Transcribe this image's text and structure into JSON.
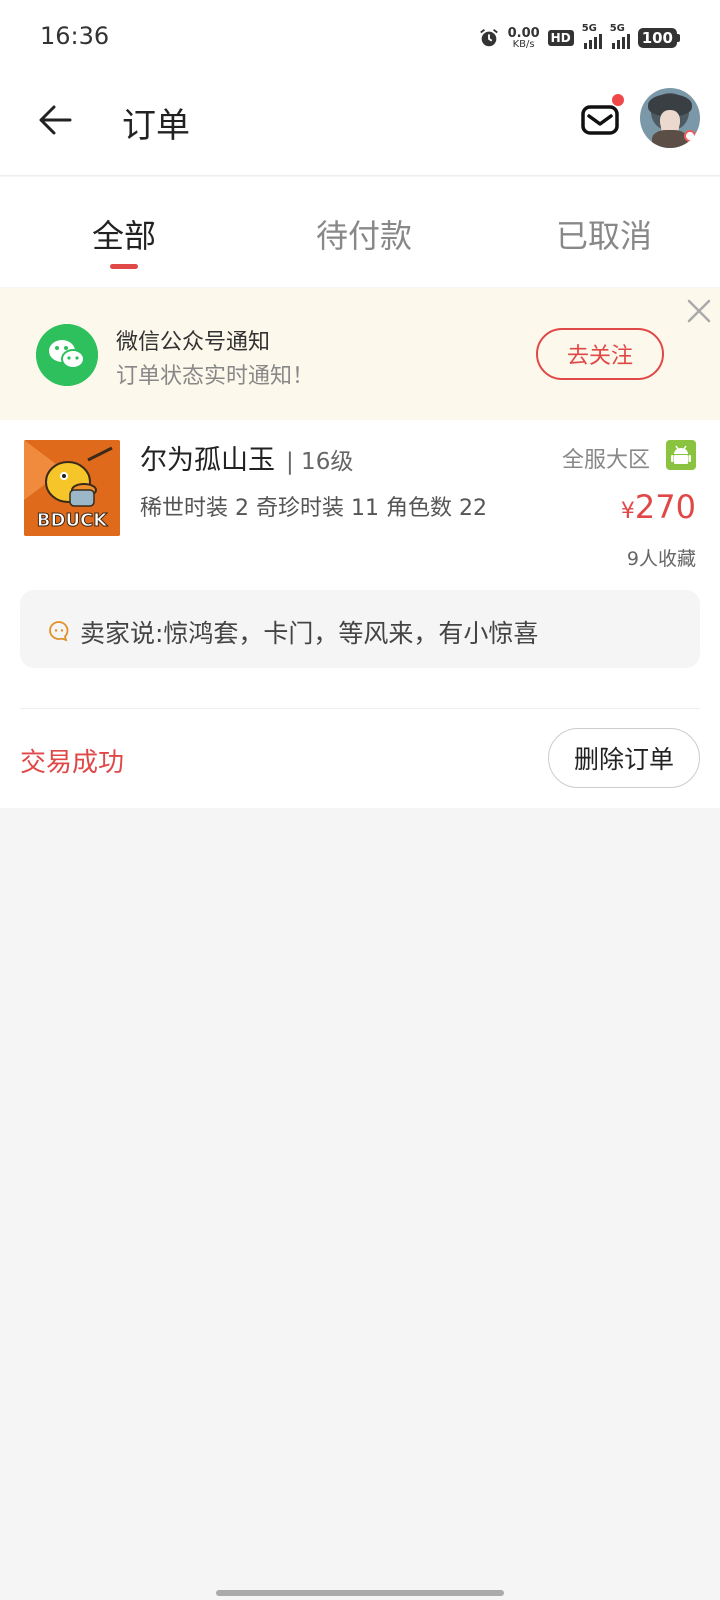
{
  "status_bar": {
    "time": "16:36",
    "net_speed_value": "0.00",
    "net_speed_unit": "KB/s",
    "hd_label": "HD",
    "sim1_label": "5G",
    "sim2_label": "5G",
    "battery": "100"
  },
  "header": {
    "title": "订单"
  },
  "tabs": [
    {
      "label": "全部",
      "active": true
    },
    {
      "label": "待付款",
      "active": false
    },
    {
      "label": "已取消",
      "active": false
    }
  ],
  "banner": {
    "title": "微信公众号通知",
    "subtitle": "订单状态实时通知！",
    "follow_label": "去关注"
  },
  "order": {
    "product_name": "尔为孤山玉",
    "level": "| 16级",
    "description": "稀世时装 2 奇珍时装 11 角色数 22",
    "region": "全服大区",
    "price_currency": "¥",
    "price_value": "270",
    "favorites": "9人收藏",
    "seller_note": "卖家说:惊鸿套，卡门，等风来，有小惊喜",
    "status": "交易成功",
    "delete_label": "删除订单",
    "thumbnail_logo_text": "BDUCK"
  },
  "colors": {
    "accent": "#e04848",
    "banner_bg": "#fdf8ec",
    "wechat_green": "#2dc05c",
    "android_green": "#8ac340"
  }
}
